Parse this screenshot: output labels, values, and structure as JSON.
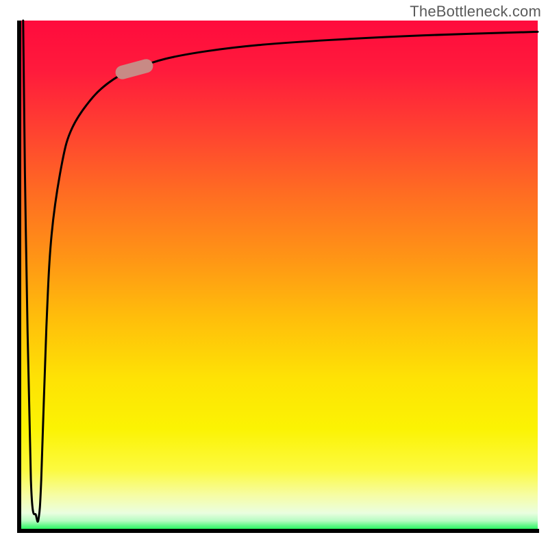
{
  "watermark": "TheBottleneck.com",
  "colors": {
    "gradient_top": "#ff0b3d",
    "gradient_mid": "#fee205",
    "gradient_bottom": "#06f54a",
    "axis": "#000000",
    "curve": "#000000",
    "marker": "#c88a85"
  },
  "chart_data": {
    "type": "line",
    "title": "",
    "xlabel": "",
    "ylabel": "",
    "xlim": [
      0,
      100
    ],
    "ylim": [
      0,
      100
    ],
    "series": [
      {
        "name": "bottleneck-curve",
        "x": [
          0.5,
          1,
          2,
          3,
          3.5,
          4,
          5,
          6,
          8,
          10,
          14,
          18,
          22,
          28,
          36,
          46,
          60,
          78,
          100
        ],
        "y": [
          100,
          60,
          10,
          3,
          2.5,
          10,
          40,
          58,
          72,
          79,
          85,
          88.5,
          90.5,
          92.5,
          94,
          95.2,
          96.2,
          97.1,
          97.8
        ]
      }
    ],
    "marker": {
      "x_center": 22,
      "y_center": 90.5,
      "rotation_deg": -15
    },
    "grid": false,
    "legend": false
  }
}
